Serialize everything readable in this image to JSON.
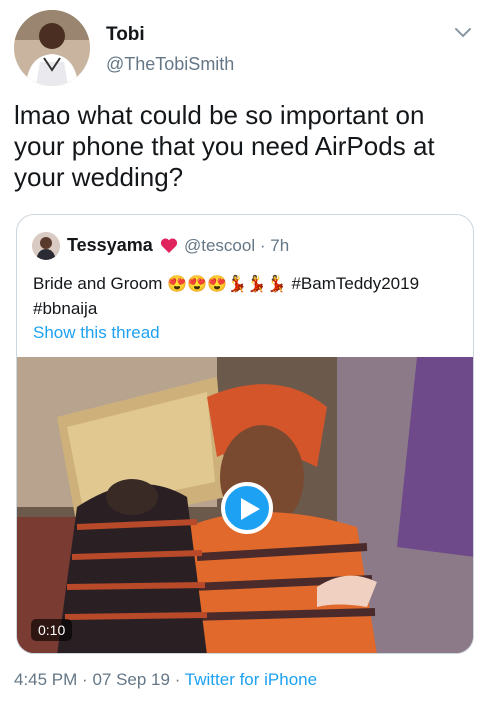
{
  "author": {
    "name": "Tobi",
    "handle": "@TheTobiSmith",
    "avatar_icon": "user-avatar"
  },
  "tweet": {
    "text": "lmao what could be so important on your phone that you need AirPods at your wedding?"
  },
  "quoted": {
    "name": "Tessyama",
    "handle": "@tescool",
    "separator": "·",
    "time": "7h",
    "text_start": "Bride and Groom",
    "emojis": [
      "😍",
      "😍",
      "😍",
      "💃",
      "💃",
      "💃"
    ],
    "hashtag_1": "#BamTeddy2019",
    "hashtag_2": "#bbnaija",
    "show_thread": "Show this thread",
    "video_duration": "0:10"
  },
  "footer": {
    "time": "4:45 PM",
    "separator": "·",
    "date": "07 Sep 19",
    "source": "Twitter for iPhone"
  },
  "colors": {
    "accent": "#1da1f2",
    "text": "#14171a",
    "secondary": "#657786",
    "heart": "#e0245e"
  }
}
